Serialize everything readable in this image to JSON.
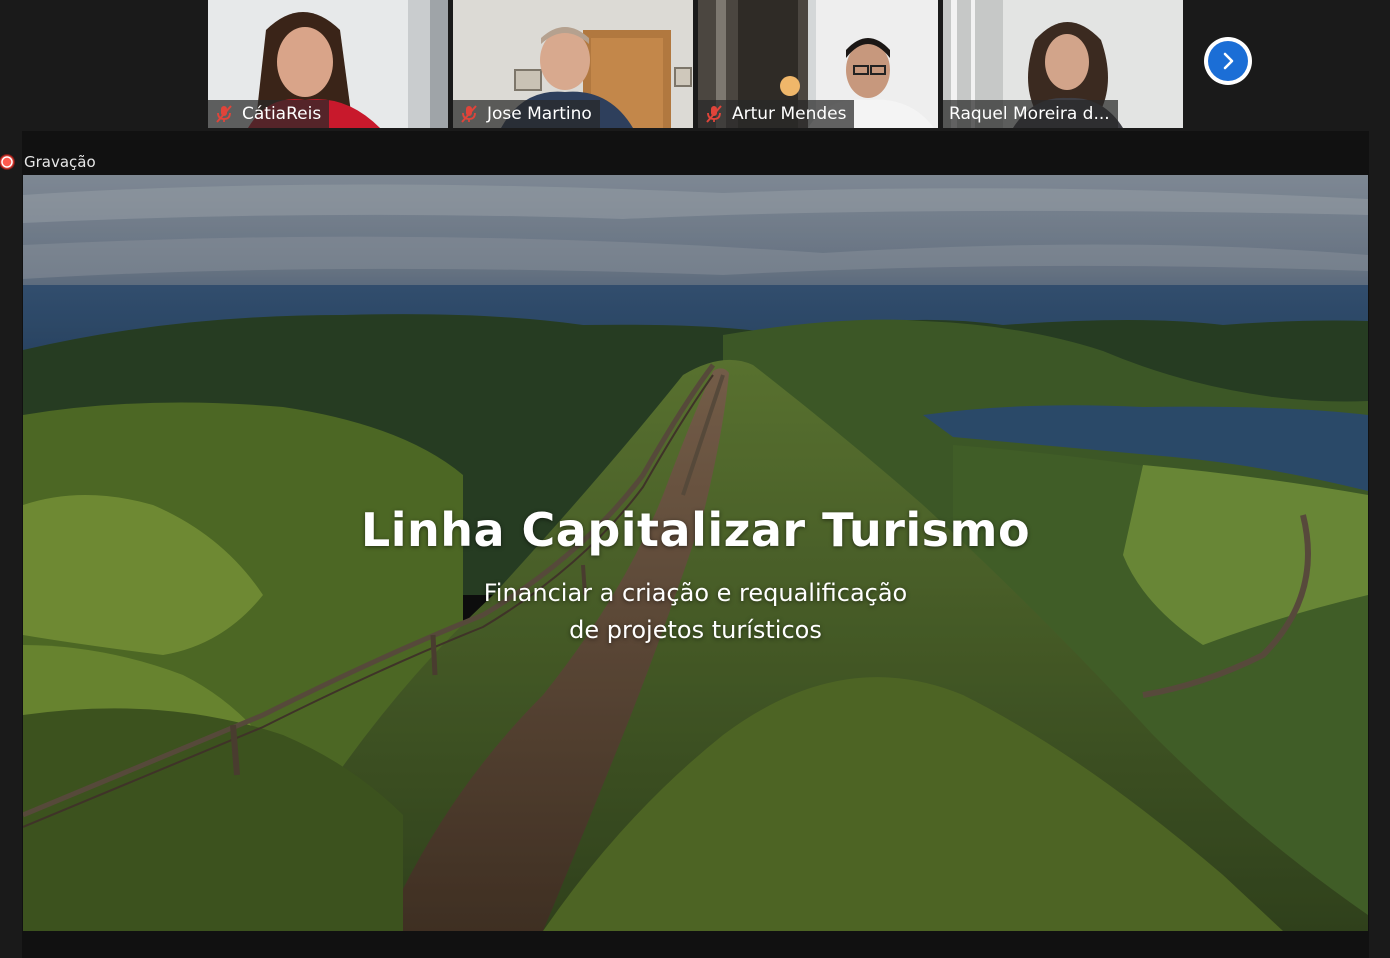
{
  "participants": [
    {
      "name": "CátiaReis",
      "muted": true,
      "icon": "mic-off-icon"
    },
    {
      "name": "Jose Martino",
      "muted": true,
      "icon": "mic-off-icon"
    },
    {
      "name": "Artur Mendes",
      "muted": true,
      "icon": "mic-off-icon"
    },
    {
      "name": "Raquel Moreira d...",
      "muted": false
    }
  ],
  "next_button": {
    "icon": "chevron-right-icon"
  },
  "recording": {
    "label": "Gravação",
    "icon": "record-dot-icon"
  },
  "slide": {
    "title": "Linha Capitalizar Turismo",
    "subtitle_line1": "Financiar a criação e requalificação",
    "subtitle_line2": "de projetos turísticos"
  },
  "colors": {
    "accent": "#1b6ed6",
    "mic_off": "#e0443a",
    "recording": "#d7382f",
    "background": "#1a1a1a"
  }
}
